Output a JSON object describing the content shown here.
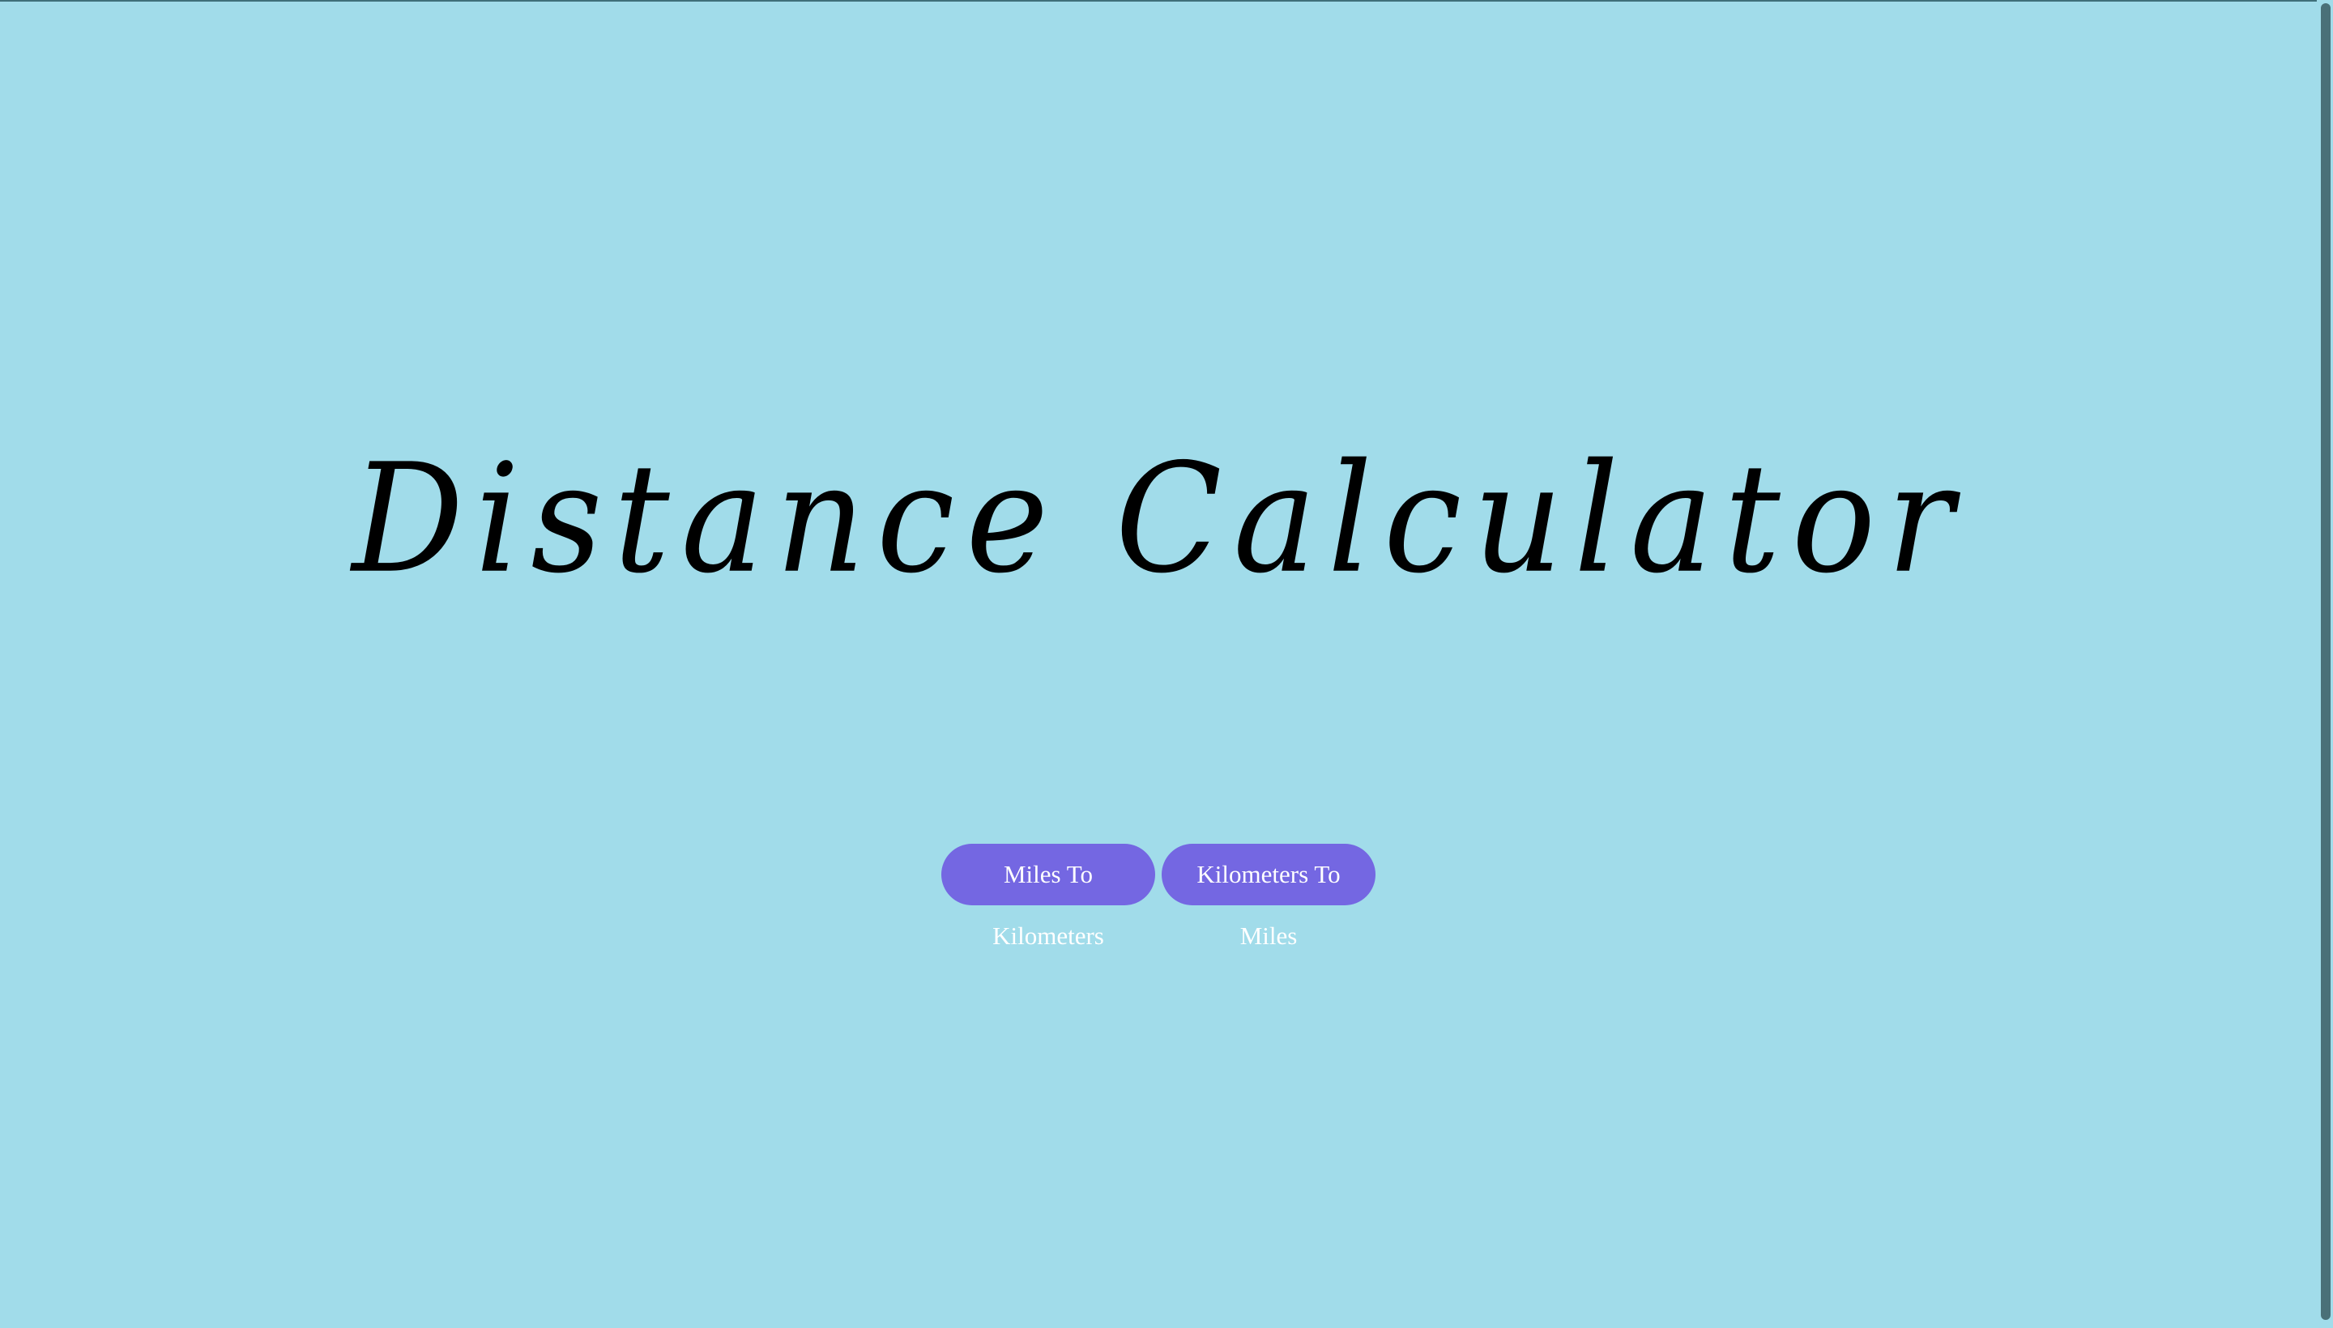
{
  "page": {
    "title": "Distance Calculator",
    "background_color": "#a1dcea"
  },
  "buttons": {
    "miles_to_km_label": "Miles To Kilometers",
    "km_to_miles_label": "Kilometers To Miles",
    "color": "#7467e2"
  }
}
